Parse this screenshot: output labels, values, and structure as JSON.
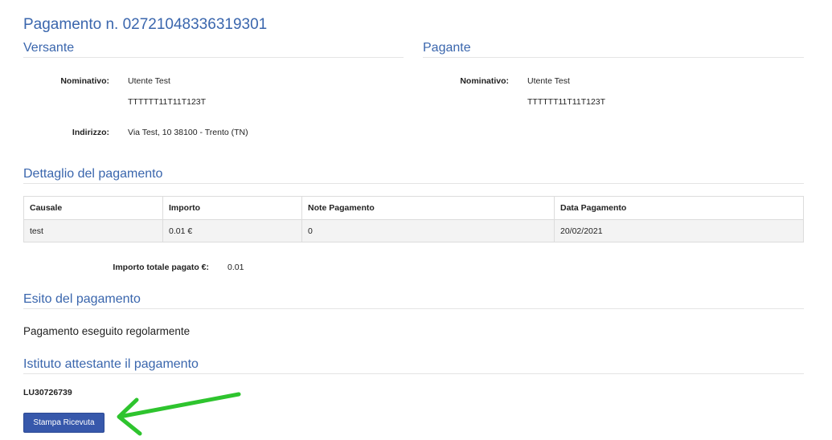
{
  "title": "Pagamento n. 02721048336319301",
  "versante": {
    "heading": "Versante",
    "nominativo_label": "Nominativo:",
    "nominativo": "Utente Test",
    "codice_fiscale": "TTTTTT11T11T123T",
    "indirizzo_label": "Indirizzo:",
    "indirizzo": "Via Test, 10 38100 - Trento (TN)"
  },
  "pagante": {
    "heading": "Pagante",
    "nominativo_label": "Nominativo:",
    "nominativo": "Utente Test",
    "codice_fiscale": "TTTTTT11T11T123T"
  },
  "dettaglio": {
    "heading": "Dettaglio del pagamento",
    "columns": [
      "Causale",
      "Importo",
      "Note Pagamento",
      "Data Pagamento"
    ],
    "rows": [
      [
        "test",
        "0.01 €",
        "0",
        "20/02/2021"
      ]
    ],
    "totale_label": "Importo totale pagato €:",
    "totale_value": "0.01"
  },
  "esito": {
    "heading": "Esito del pagamento",
    "text": "Pagamento eseguito regolarmente"
  },
  "istituto": {
    "heading": "Istituto attestante il pagamento",
    "code": "LU30726739"
  },
  "actions": {
    "stampa_label": "Stampa Ricevuta"
  },
  "colors": {
    "heading": "#3a66ad",
    "button": "#3758ab",
    "annotation_arrow": "#2ec42e"
  }
}
